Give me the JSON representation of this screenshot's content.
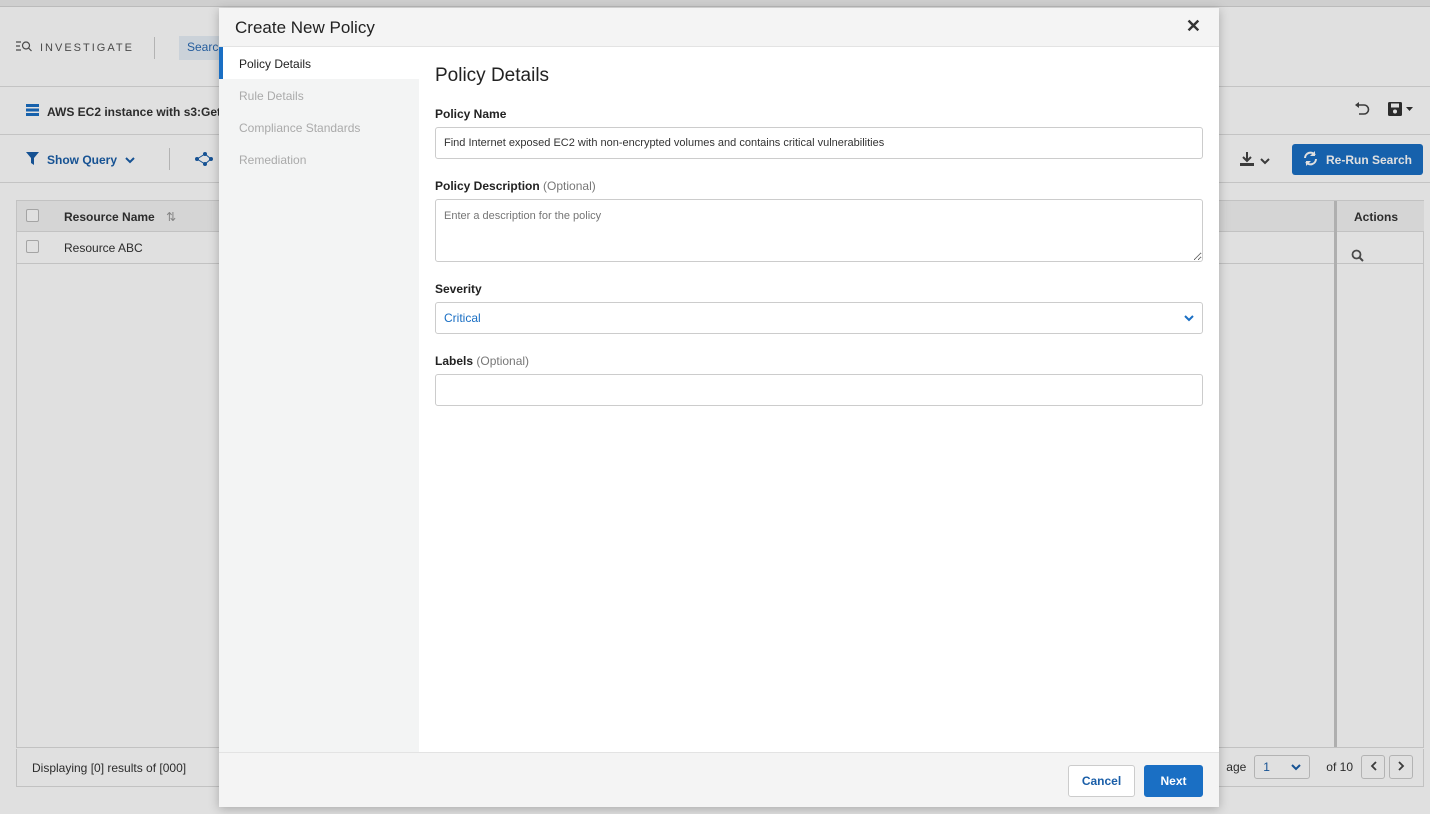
{
  "app": {
    "nav_label": "INVESTIGATE",
    "search_tab": "Searc",
    "query_title": "AWS EC2 instance with s3:GetO",
    "show_query": "Show Query",
    "rerun_label": "Re-Run Search",
    "table": {
      "columns": [
        "Resource Name",
        "Actions"
      ],
      "rows": [
        {
          "resource_name": "Resource ABC"
        }
      ]
    },
    "footer": {
      "displaying": "Displaying [0] results of [000]",
      "page_label": "age",
      "page_value": "1",
      "page_total": "of 10"
    }
  },
  "modal": {
    "title": "Create New Policy",
    "steps": [
      {
        "label": "Policy Details",
        "active": true
      },
      {
        "label": "Rule Details",
        "active": false
      },
      {
        "label": "Compliance Standards",
        "active": false
      },
      {
        "label": "Remediation",
        "active": false
      }
    ],
    "section_title": "Policy Details",
    "policy_name": {
      "label": "Policy Name",
      "value": "Find Internet exposed EC2 with non-encrypted volumes and contains critical vulnerabilities"
    },
    "policy_description": {
      "label": "Policy Description",
      "optional": "(Optional)",
      "placeholder": "Enter a description for the policy"
    },
    "severity": {
      "label": "Severity",
      "value": "Critical"
    },
    "labels": {
      "label": "Labels",
      "optional": "(Optional)"
    },
    "cancel": "Cancel",
    "next": "Next"
  },
  "colors": {
    "accent": "#1a6fc4",
    "link": "#1a5ea8"
  }
}
